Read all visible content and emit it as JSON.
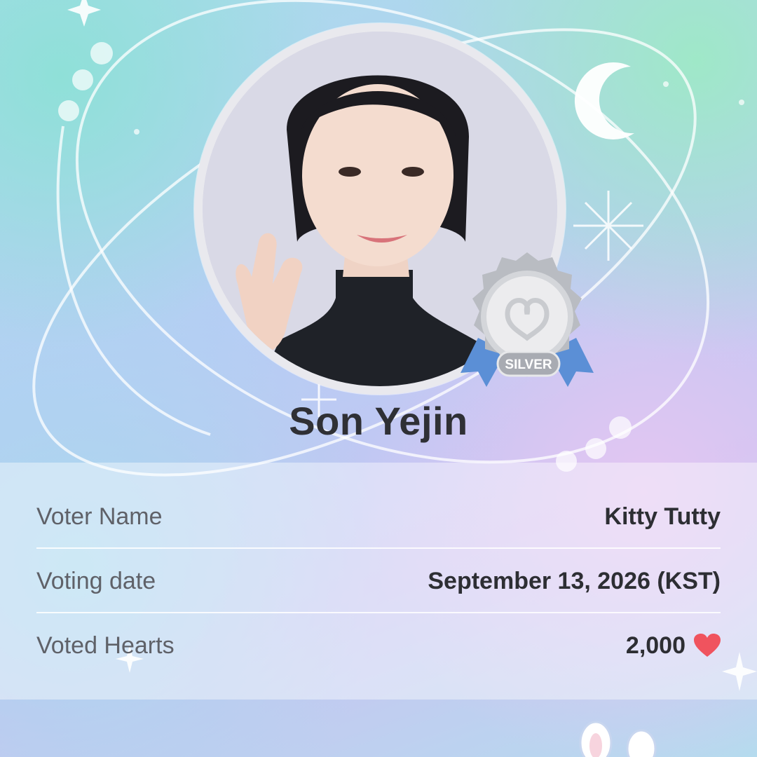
{
  "artist": {
    "name": "Son Yejin"
  },
  "badge": {
    "tier": "SILVER",
    "icon": "silver-ribbon-icon"
  },
  "vote_info": {
    "rows": [
      {
        "label": "Voter Name",
        "value": "Kitty Tutty"
      },
      {
        "label": "Voting date",
        "value": "September 13, 2026 (KST)"
      },
      {
        "label": "Voted Hearts",
        "value": "2,000",
        "icon": "heart-icon"
      }
    ]
  },
  "colors": {
    "heart": "#f0535e",
    "name_text": "#2f3035",
    "label_text": "#5f6168",
    "badge_silver": "#bfc1c6",
    "ribbon_blue": "#5b8fd6"
  }
}
